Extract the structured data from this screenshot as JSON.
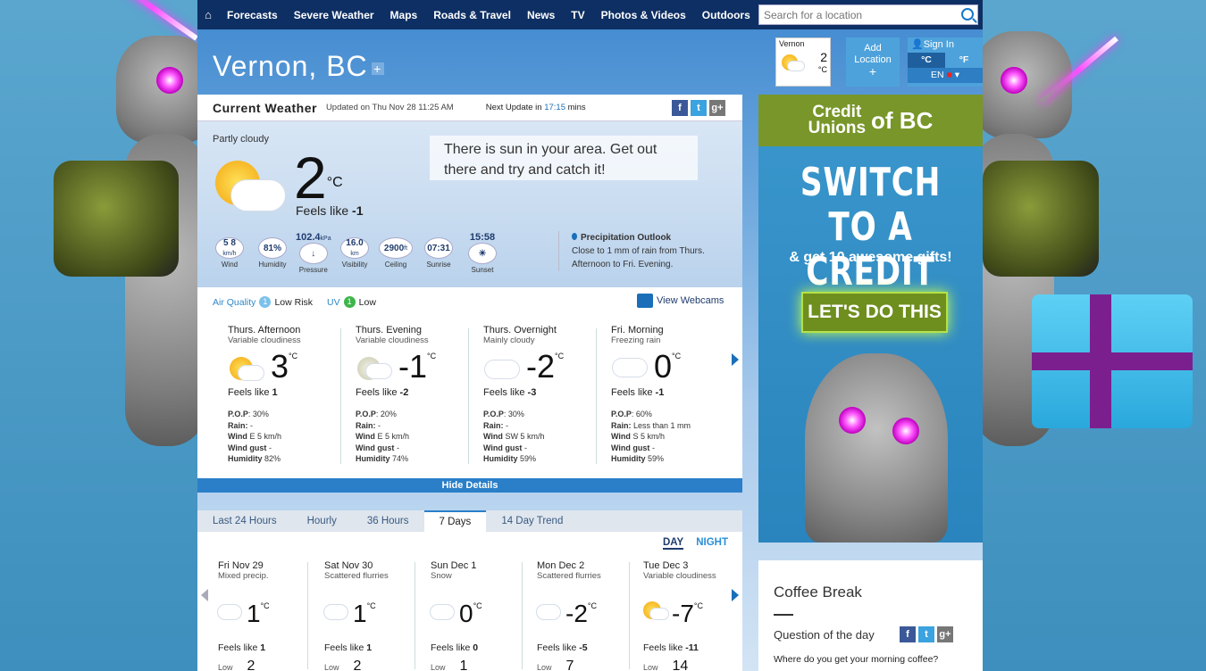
{
  "nav": {
    "items": [
      "Forecasts",
      "Severe Weather",
      "Maps",
      "Roads & Travel",
      "News",
      "TV",
      "Photos & Videos",
      "Outdoors"
    ],
    "search_placeholder": "Search for a location"
  },
  "city": "Vernon, BC",
  "current": {
    "title": "Current Weather",
    "updated": "Updated on Thu Nov 28 11:25 AM",
    "next_update_prefix": "Next Update in",
    "next_update_value": "17:15",
    "next_update_suffix": "mins",
    "condition": "Partly cloudy",
    "temp": "2",
    "unit": "°C",
    "feels_label": "Feels like",
    "feels_value": "-1",
    "message": "There is sun in your area. Get out there and try and catch it!",
    "stats": [
      {
        "value": "5 8",
        "unit": "km/h",
        "label": "Wind"
      },
      {
        "value": "81%",
        "label": "Humidity"
      },
      {
        "value": "102.4",
        "unit": "kPa",
        "label": "Pressure"
      },
      {
        "value": "16.0",
        "unit": "km",
        "label": "Visibility"
      },
      {
        "value": "2900",
        "unit": "ft",
        "label": "Ceiling"
      },
      {
        "value": "07:31",
        "label": "Sunrise"
      },
      {
        "value": "15:58",
        "label": "Sunset"
      }
    ],
    "precip_title": "Precipitation Outlook",
    "precip_text": "Close to 1 mm of rain from Thurs. Afternoon to Fri. Evening.",
    "air_quality_label": "Air Quality",
    "air_quality_index": "1",
    "air_quality_value": "Low Risk",
    "uv_label": "UV",
    "uv_index": "1",
    "uv_value": "Low",
    "webcams": "View Webcams"
  },
  "periods": [
    {
      "name": "Thurs. Afternoon",
      "desc": "Variable cloudiness",
      "temp": "3",
      "feels": "Feels like",
      "feels_v": "1",
      "pop": "30%",
      "rain": "-",
      "wind": "E 5 km/h",
      "gust": "-",
      "humidity": "82%"
    },
    {
      "name": "Thurs. Evening",
      "desc": "Variable cloudiness",
      "temp": "-1",
      "feels": "Feels like",
      "feels_v": "-2",
      "pop": "20%",
      "rain": "-",
      "wind": "E 5 km/h",
      "gust": "-",
      "humidity": "74%"
    },
    {
      "name": "Thurs. Overnight",
      "desc": "Mainly cloudy",
      "temp": "-2",
      "feels": "Feels like",
      "feels_v": "-3",
      "pop": "30%",
      "rain": "-",
      "wind": "SW 5 km/h",
      "gust": "-",
      "humidity": "59%"
    },
    {
      "name": "Fri. Morning",
      "desc": "Freezing rain",
      "temp": "0",
      "feels": "Feels like",
      "feels_v": "-1",
      "pop": "60%",
      "rain": "Less than 1 mm",
      "wind": "S 5 km/h",
      "gust": "-",
      "humidity": "59%"
    }
  ],
  "labels": {
    "pop": "P.O.P",
    "rain": "Rain:",
    "wind": "Wind",
    "gust": "Wind gust",
    "humidity": "Humidity",
    "deg": "°C",
    "low": "Low"
  },
  "hide_details": "Hide Details",
  "tabs": [
    "Last 24 Hours",
    "Hourly",
    "36 Hours",
    "7 Days",
    "14 Day Trend"
  ],
  "day_night": {
    "day": "DAY",
    "night": "NIGHT"
  },
  "days": [
    {
      "date": "Fri Nov 29",
      "desc": "Mixed precip.",
      "temp": "1",
      "feels": "1",
      "low": "2"
    },
    {
      "date": "Sat Nov 30",
      "desc": "Scattered flurries",
      "temp": "1",
      "feels": "1",
      "low": "2"
    },
    {
      "date": "Sun Dec 1",
      "desc": "Snow",
      "temp": "0",
      "feels": "0",
      "low": "1"
    },
    {
      "date": "Mon Dec 2",
      "desc": "Scattered flurries",
      "temp": "-2",
      "feels": "-5",
      "low": "7"
    },
    {
      "date": "Tue Dec 3",
      "desc": "Variable cloudiness",
      "temp": "-7",
      "feels": "-11",
      "low": "14"
    }
  ],
  "mini": {
    "city": "Vernon",
    "temp": "2",
    "unit": "°C"
  },
  "add_location": {
    "l1": "Add",
    "l2": "Location",
    "l3": "+"
  },
  "signin": {
    "label": "Sign In",
    "c": "°C",
    "f": "°F",
    "lang": "EN"
  },
  "ad": {
    "brand1": "Credit",
    "brand2": "Unions",
    "brand3": "of BC",
    "big1": "SWITCH TO A",
    "big2": "CREDIT UNION",
    "sub": "& get 10 awesome gifts!",
    "cta": "LET'S DO THIS"
  },
  "coffee": {
    "title": "Coffee Break",
    "question_label": "Question of the day",
    "question": "Where do you get your morning coffee?"
  },
  "colors": {
    "nav": "#0e2f63",
    "accent": "#2a7fc8",
    "ad_green": "#79962a"
  }
}
